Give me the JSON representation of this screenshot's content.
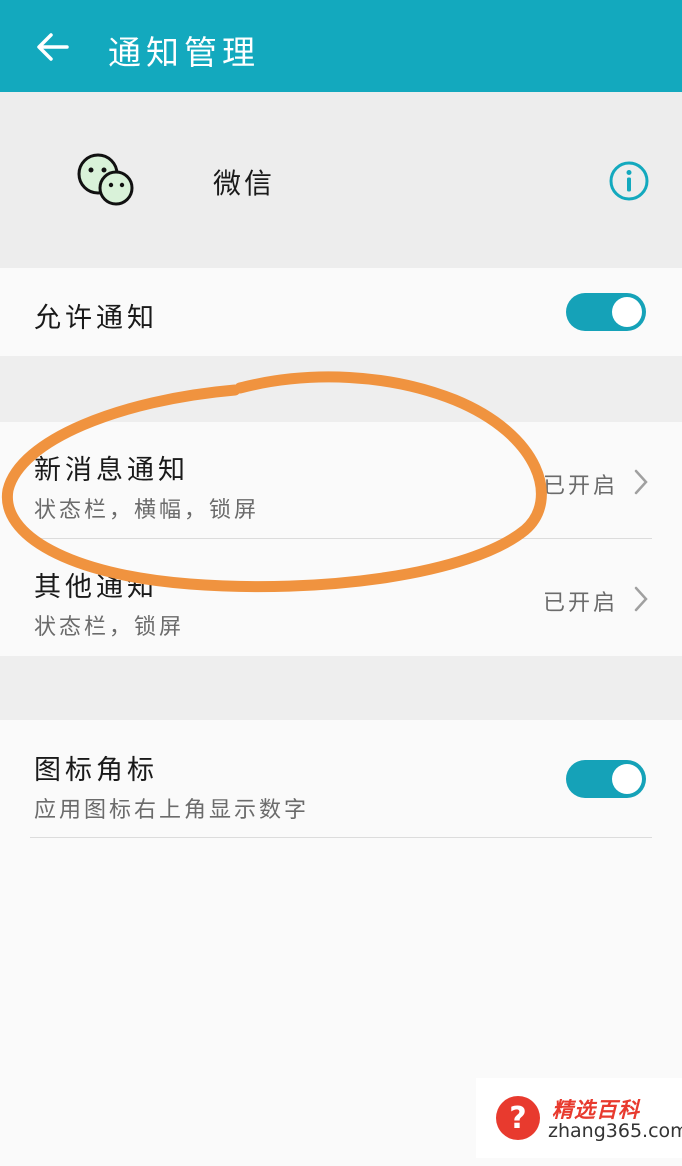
{
  "header": {
    "title": "通知管理"
  },
  "app": {
    "name": "微信"
  },
  "allow_notifications": {
    "label": "允许通知",
    "enabled": true
  },
  "notification_items": [
    {
      "label": "新消息通知",
      "subtitle": "状态栏，横幅，锁屏",
      "status": "已开启"
    },
    {
      "label": "其他通知",
      "subtitle": "状态栏，锁屏",
      "status": "已开启"
    }
  ],
  "badge": {
    "label": "图标角标",
    "subtitle": "应用图标右上角显示数字",
    "enabled": true
  },
  "colors": {
    "header": "#13a9be",
    "toggle_on": "#15a2b8",
    "annotation_circle": "#f0933f"
  },
  "watermark": {
    "brand": "精选百科",
    "url": "zhang365.com"
  }
}
